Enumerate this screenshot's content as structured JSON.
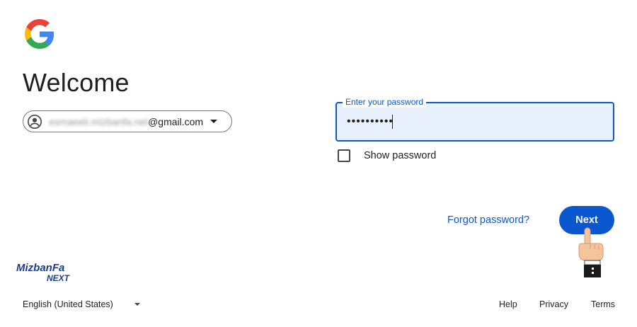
{
  "page": {
    "title": "Welcome"
  },
  "account": {
    "email_user": "esmaeeli.mizbanfa.net",
    "email_domain": "@gmail.com"
  },
  "password": {
    "label": "Enter your password",
    "value": "••••••••••"
  },
  "show_password": {
    "label": "Show password",
    "checked": false
  },
  "actions": {
    "forgot_label": "Forgot password?",
    "next_label": "Next"
  },
  "watermark": {
    "brand_top": "MizbanFa",
    "brand_bottom": "NEXT"
  },
  "footer": {
    "language": "English (United States)",
    "help": "Help",
    "privacy": "Privacy",
    "terms": "Terms"
  },
  "colors": {
    "accent": "#0b57d0",
    "field_bg": "#e8f0fe",
    "text": "#1f1f1f"
  },
  "icons": {
    "logo": "google-g-icon",
    "avatar": "account-circle-icon",
    "caret": "chevron-down-icon",
    "hand": "pointing-hand-icon"
  }
}
